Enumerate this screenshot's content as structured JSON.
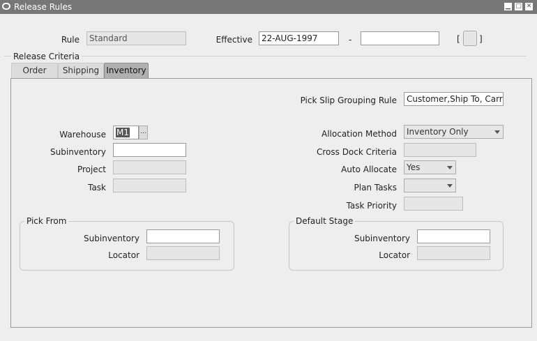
{
  "window": {
    "title": "Release Rules"
  },
  "header": {
    "rule_label": "Rule",
    "rule_value": "Standard",
    "effective_label": "Effective",
    "effective_from": "22-AUG-1997",
    "effective_dash": "-",
    "effective_to": "",
    "bracket_open": "[",
    "bracket_close": "]"
  },
  "section": {
    "title": "Release Criteria"
  },
  "tabs": [
    {
      "label": "Order",
      "active": false
    },
    {
      "label": "Shipping",
      "active": false
    },
    {
      "label": "Inventory",
      "active": true
    }
  ],
  "inventory": {
    "pick_slip_label": "Pick Slip Grouping Rule",
    "pick_slip_value": "Customer,Ship To, Carri",
    "warehouse_label": "Warehouse",
    "warehouse_value": "M1",
    "lov_glyph": "...",
    "subinventory_label": "Subinventory",
    "subinventory_value": "",
    "project_label": "Project",
    "project_value": "",
    "task_label": "Task",
    "task_value": "",
    "allocation_method_label": "Allocation Method",
    "allocation_method_value": "Inventory Only",
    "cross_dock_label": "Cross Dock Criteria",
    "cross_dock_value": "",
    "auto_allocate_label": "Auto Allocate",
    "auto_allocate_value": "Yes",
    "plan_tasks_label": "Plan Tasks",
    "plan_tasks_value": "",
    "task_priority_label": "Task Priority",
    "task_priority_value": "",
    "pick_from": {
      "title": "Pick From",
      "subinventory_label": "Subinventory",
      "subinventory_value": "",
      "locator_label": "Locator",
      "locator_value": ""
    },
    "default_stage": {
      "title": "Default Stage",
      "subinventory_label": "Subinventory",
      "subinventory_value": "",
      "locator_label": "Locator",
      "locator_value": ""
    }
  }
}
